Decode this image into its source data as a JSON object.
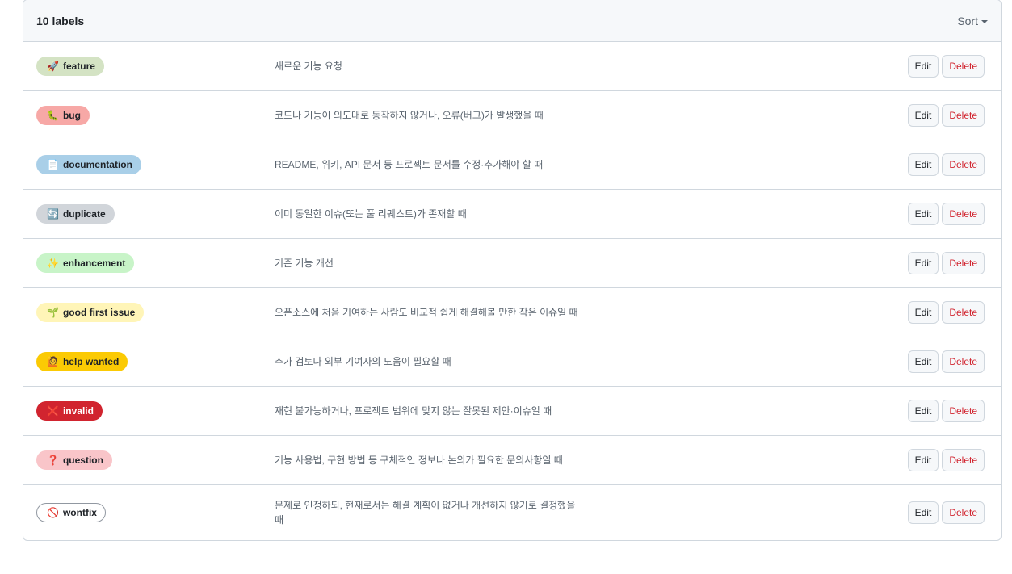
{
  "header": {
    "count_label": "10 labels",
    "sort_label": "Sort"
  },
  "labels": [
    {
      "name": "feature",
      "icon": "🚀",
      "icon_name": "rocket-icon",
      "bg": "#d4e3c4",
      "fg": "#1f2328",
      "border": "#d4e3c4",
      "description": "새로운 기능 요청"
    },
    {
      "name": "bug",
      "icon": "🐛",
      "icon_name": "bug-icon",
      "bg": "#f7a8a6",
      "fg": "#1f2328",
      "border": "#f7a8a6",
      "description": "코드나 기능이 의도대로 동작하지 않거나, 오류(버그)가 발생했을 때"
    },
    {
      "name": "documentation",
      "icon": "📄",
      "icon_name": "document-icon",
      "bg": "#a9cfe8",
      "fg": "#1f2328",
      "border": "#a9cfe8",
      "description": "README, 위키, API 문서 등 프로젝트 문서를 수정·추가해야 할 때"
    },
    {
      "name": "duplicate",
      "icon": "🔄",
      "icon_name": "refresh-icon",
      "bg": "#d1d5da",
      "fg": "#1f2328",
      "border": "#d1d5da",
      "description": "이미 동일한 이슈(또는 풀 리퀘스트)가 존재할 때"
    },
    {
      "name": "enhancement",
      "icon": "✨",
      "icon_name": "sparkles-icon",
      "bg": "#c8f4c8",
      "fg": "#1f2328",
      "border": "#c8f4c8",
      "description": "기존 기능 개선"
    },
    {
      "name": "good first issue",
      "icon": "🌱",
      "icon_name": "seedling-icon",
      "bg": "#fff5b8",
      "fg": "#1f2328",
      "border": "#fff5b8",
      "description": "오픈소스에 처음 기여하는 사람도 비교적 쉽게 해결해볼 만한 작은 이슈일 때"
    },
    {
      "name": "help wanted",
      "icon": "🙋",
      "icon_name": "raising-hand-icon",
      "bg": "#fbca04",
      "fg": "#1f2328",
      "border": "#fbca04",
      "description": "추가 검토나 외부 기여자의 도움이 필요할 때"
    },
    {
      "name": "invalid",
      "icon": "❌",
      "icon_name": "cross-mark-icon",
      "bg": "#d1242f",
      "fg": "#ffffff",
      "border": "#d1242f",
      "description": "재현 불가능하거나, 프로젝트 범위에 맞지 않는 잘못된 제안·이슈일 때"
    },
    {
      "name": "question",
      "icon": "❓",
      "icon_name": "question-mark-icon",
      "bg": "#f9c5c9",
      "fg": "#1f2328",
      "border": "#f9c5c9",
      "description": "기능 사용법, 구현 방법 등 구체적인 정보나 논의가 필요한 문의사항일 때"
    },
    {
      "name": "wontfix",
      "icon": "🚫",
      "icon_name": "prohibited-icon",
      "bg": "#ffffff",
      "fg": "#1f2328",
      "border": "#9198a1",
      "description": "문제로 인정하되, 현재로서는 해결 계획이 없거나 개선하지 않기로 결정했을 때"
    }
  ],
  "actions": {
    "edit_label": "Edit",
    "delete_label": "Delete"
  }
}
